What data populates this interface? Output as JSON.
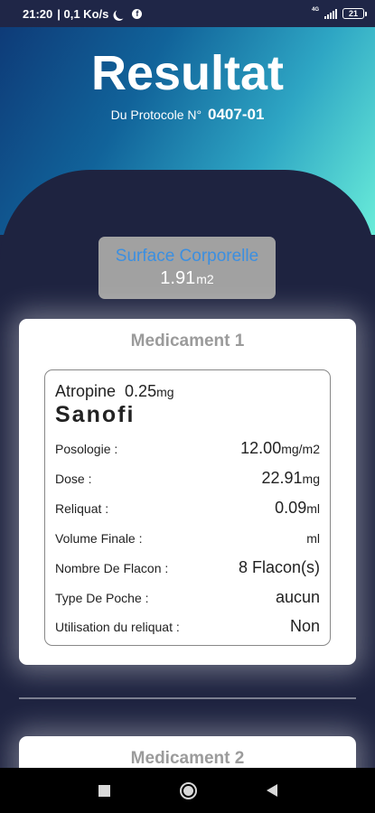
{
  "status_bar": {
    "time": "21:20",
    "speed": "| 0,1 Ko/s",
    "network": "4G",
    "battery": "21"
  },
  "header": {
    "title": "Resultat",
    "subtitle_prefix": "Du Protocole N°",
    "protocol_code": "0407-01"
  },
  "surface": {
    "label": "Surface Corporelle",
    "value": "1.91",
    "unit": "m2"
  },
  "medicament1": {
    "title": "Medicament 1",
    "drug": "Atropine",
    "dose": "0.25",
    "dose_unit": "mg",
    "maker": "Sanofi",
    "rows": [
      {
        "label": "Posologie :",
        "value": "12.00",
        "unit": "mg/m2"
      },
      {
        "label": "Dose :",
        "value": "22.91",
        "unit": "mg"
      },
      {
        "label": "Reliquat :",
        "value": "0.09",
        "unit": "ml"
      },
      {
        "label": "Volume Finale :",
        "value": "",
        "unit": "ml"
      },
      {
        "label": "Nombre De Flacon :",
        "value": "8 Flacon(s)",
        "unit": ""
      },
      {
        "label": "Type De Poche :",
        "value": "aucun",
        "unit": ""
      },
      {
        "label": "Utilisation du reliquat :",
        "value": "Non",
        "unit": ""
      }
    ]
  },
  "medicament2": {
    "title": "Medicament 2"
  },
  "nav": {
    "icons": [
      "recent-apps-icon",
      "home-icon",
      "back-icon"
    ]
  }
}
